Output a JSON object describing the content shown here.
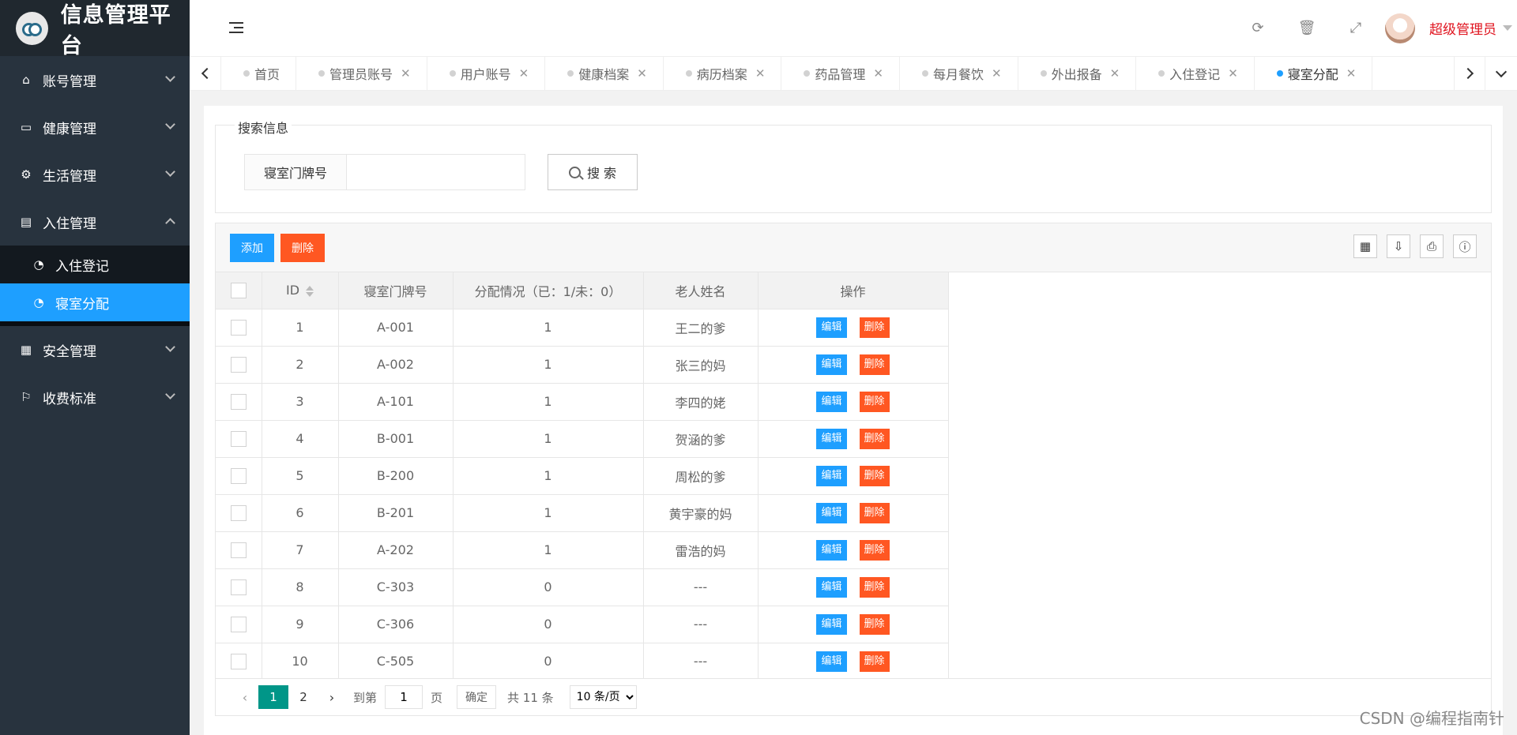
{
  "app": {
    "title": "信息管理平台"
  },
  "sidebar": {
    "items": [
      {
        "label": "账号管理",
        "icon": "home-icon"
      },
      {
        "label": "健康管理",
        "icon": "window-icon"
      },
      {
        "label": "生活管理",
        "icon": "gears-icon"
      },
      {
        "label": "入住管理",
        "icon": "file-icon",
        "expanded": true
      },
      {
        "label": "安全管理",
        "icon": "calendar-icon"
      },
      {
        "label": "收费标准",
        "icon": "flag-icon"
      }
    ],
    "sub_items": [
      {
        "label": "入住登记",
        "icon": "dashboard-icon",
        "active": false
      },
      {
        "label": "寝室分配",
        "icon": "dashboard-icon",
        "active": true
      }
    ]
  },
  "header": {
    "user_name": "超级管理员",
    "accent": "#1e9fff"
  },
  "tabs": [
    {
      "label": "首页",
      "closable": false
    },
    {
      "label": "管理员账号",
      "closable": true
    },
    {
      "label": "用户账号",
      "closable": true
    },
    {
      "label": "健康档案",
      "closable": true
    },
    {
      "label": "病历档案",
      "closable": true
    },
    {
      "label": "药品管理",
      "closable": true
    },
    {
      "label": "每月餐饮",
      "closable": true
    },
    {
      "label": "外出报备",
      "closable": true
    },
    {
      "label": "入住登记",
      "closable": true
    },
    {
      "label": "寝室分配",
      "closable": true,
      "active": true
    }
  ],
  "search": {
    "legend": "搜索信息",
    "label": "寝室门牌号",
    "value": "",
    "button": "搜 索"
  },
  "toolbar": {
    "add_label": "添加",
    "delete_label": "删除"
  },
  "table": {
    "columns": [
      "ID",
      "寝室门牌号",
      "分配情况（已：1/未：0）",
      "老人姓名",
      "操作"
    ],
    "edit_label": "编辑",
    "delete_label": "删除",
    "rows": [
      {
        "id": "1",
        "room": "A-001",
        "status": "1",
        "name": "王二的爹"
      },
      {
        "id": "2",
        "room": "A-002",
        "status": "1",
        "name": "张三的妈"
      },
      {
        "id": "3",
        "room": "A-101",
        "status": "1",
        "name": "李四的姥"
      },
      {
        "id": "4",
        "room": "B-001",
        "status": "1",
        "name": "贺涵的爹"
      },
      {
        "id": "5",
        "room": "B-200",
        "status": "1",
        "name": "周松的爹"
      },
      {
        "id": "6",
        "room": "B-201",
        "status": "1",
        "name": "黄宇豪的妈"
      },
      {
        "id": "7",
        "room": "A-202",
        "status": "1",
        "name": "雷浩的妈"
      },
      {
        "id": "8",
        "room": "C-303",
        "status": "0",
        "name": "---"
      },
      {
        "id": "9",
        "room": "C-306",
        "status": "0",
        "name": "---"
      },
      {
        "id": "10",
        "room": "C-505",
        "status": "0",
        "name": "---"
      }
    ]
  },
  "pager": {
    "pages": [
      "1",
      "2"
    ],
    "current": "1",
    "goto_label": "到第",
    "goto_value": "1",
    "page_unit": "页",
    "confirm": "确定",
    "total": "共 11 条",
    "page_size": "10 条/页"
  },
  "watermark": "CSDN @编程指南针"
}
